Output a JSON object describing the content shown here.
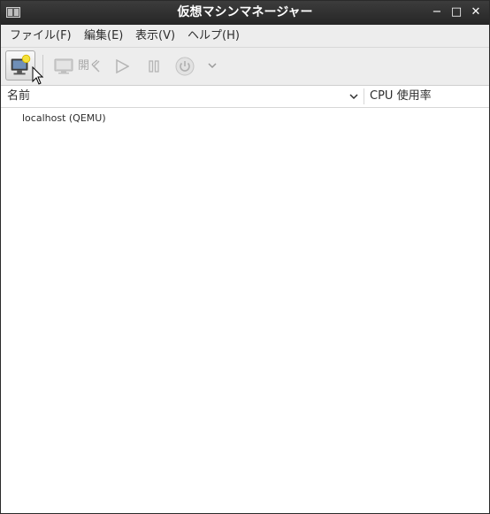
{
  "window": {
    "title": "仮想マシンマネージャー",
    "minimize_glyph": "−",
    "maximize_glyph": "□",
    "close_glyph": "✕"
  },
  "menu": {
    "items": [
      {
        "label": "ファイル(F)"
      },
      {
        "label": "編集(E)"
      },
      {
        "label": "表示(V)"
      },
      {
        "label": "ヘルプ(H)"
      }
    ]
  },
  "toolbar": {
    "new_vm_icon": "new-vm-icon",
    "open_label": "開く",
    "open_icon": "monitor-icon",
    "run_icon": "play-icon",
    "pause_icon": "pause-icon",
    "shutdown_icon": "power-icon",
    "menu_icon": "chevron-down-icon",
    "disabled_color": "#a8a8a8"
  },
  "columns": {
    "name_label": "名前",
    "cpu_label": "CPU 使用率"
  },
  "connections": [
    {
      "label": "localhost (QEMU)"
    }
  ],
  "colors": {
    "titlebar": "#2f2f2f",
    "chrome": "#ededed",
    "text": "#2e2e2e"
  }
}
